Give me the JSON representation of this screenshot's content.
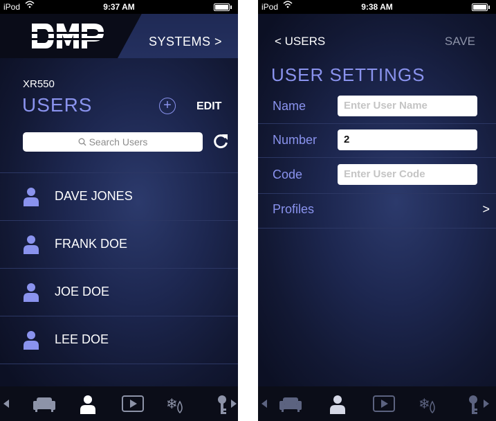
{
  "left": {
    "status": {
      "carrier": "iPod",
      "time": "9:37 AM"
    },
    "header": {
      "systems_label": "SYSTEMS >"
    },
    "panel_name": "XR550",
    "title": "USERS",
    "plus_label": "+",
    "edit_label": "EDIT",
    "search": {
      "placeholder": "Search Users"
    },
    "users": [
      {
        "name": "DAVE JONES"
      },
      {
        "name": "FRANK DOE"
      },
      {
        "name": "JOE DOE"
      },
      {
        "name": "LEE DOE"
      }
    ],
    "tabbar": {
      "active_tab": "users"
    }
  },
  "right": {
    "status": {
      "carrier": "iPod",
      "time": "9:38 AM"
    },
    "nav": {
      "back_label": "< USERS",
      "save_label": "SAVE"
    },
    "title": "USER SETTINGS",
    "fields": {
      "name": {
        "label": "Name",
        "placeholder": "Enter User Name",
        "value": ""
      },
      "number": {
        "label": "Number",
        "value": "2"
      },
      "code": {
        "label": "Code",
        "placeholder": "Enter User Code",
        "value": ""
      }
    },
    "profiles_label": "Profiles",
    "profiles_chevron": ">",
    "tabbar": {
      "active_tab": "users"
    }
  },
  "colors": {
    "accent": "#8a93ee",
    "background": "#1d2750",
    "statusbar": "#000000"
  },
  "icons": [
    "wifi-icon",
    "battery-icon",
    "search-icon",
    "refresh-icon",
    "user-icon",
    "sofa-icon",
    "video-icon",
    "thermostat-icon",
    "key-icon"
  ]
}
